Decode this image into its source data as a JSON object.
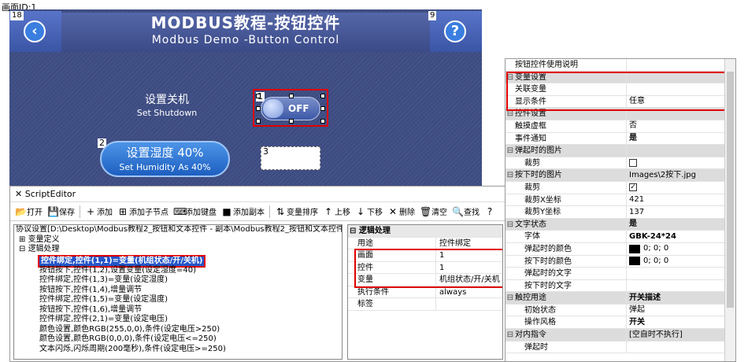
{
  "canvas": {
    "title": "画面ID:1"
  },
  "hmi": {
    "title": "MODBUS教程-按钮控件",
    "subtitle": "Modbus Demo -Button Control",
    "back_id": "18",
    "help_id": "9",
    "shutdown_cn": "设置关机",
    "shutdown_en": "Set Shutdown",
    "toggle_id": "1",
    "toggle_text": "OFF",
    "humidity_id": "2",
    "humidity_cn": "设置湿度 40%",
    "humidity_en": "Set Humidity As 40%",
    "empty_id": "3",
    "icons": {
      "back": "chevron-left-icon",
      "help": "question-icon"
    }
  },
  "script_editor": {
    "title": "ScriptEditor",
    "toolbar": [
      {
        "name": "open",
        "icon": "📂",
        "label": "打开"
      },
      {
        "name": "save",
        "icon": "💾",
        "label": "保存"
      },
      {
        "name": "add",
        "icon": "+",
        "label": "添加"
      },
      {
        "name": "add-child",
        "icon": "⊞",
        "label": "添加子节点"
      },
      {
        "name": "add-keyboard",
        "icon": "⌨",
        "label": "添加键盘"
      },
      {
        "name": "add-copy",
        "icon": "■",
        "label": "添加副本"
      },
      {
        "name": "sort-vars",
        "icon": "⇅",
        "label": "变量排序"
      },
      {
        "name": "move-up",
        "icon": "↑",
        "label": "上移"
      },
      {
        "name": "move-down",
        "icon": "↓",
        "label": "下移"
      },
      {
        "name": "delete",
        "icon": "✕",
        "label": "删除"
      },
      {
        "name": "clear",
        "icon": "🗑",
        "label": "清空"
      },
      {
        "name": "find",
        "icon": "🔍",
        "label": "查找"
      },
      {
        "name": "help",
        "icon": "?",
        "label": ""
      }
    ],
    "tree": {
      "root": "协议设置[D:\\Desktop\\Modbus教程2_按钮和文本控件 - 副本\\Modbus教程2_按钮和文本控件\\Modbus",
      "var_def": "变量定义",
      "logic": "逻辑处理",
      "selected": "控件绑定,控件(1,1)=变量(机组状态/开/关机)",
      "items": [
        "按钮按下,控件(1,2),设置变量(设定湿度=40)",
        "控件绑定,控件(1,3)=变量(设定湿度)",
        "按钮按下,控件(1,4),增量调节",
        "控件绑定,控件(1,5)=变量(设定温度)",
        "按钮按下,控件(1,6),增量调节",
        "控件绑定,控件(2,1)=变量(设定电压)",
        "颜色设置,颜色RGB(255,0,0),条件(设定电压>250)",
        "颜色设置,颜色RGB(0,0,0),条件(设定电压<=250)",
        "文本闪烁,闪烁周期(200毫秒),条件(设定电压>=250)"
      ]
    },
    "props": {
      "header": "逻辑处理",
      "rows": [
        {
          "k": "用途",
          "v": "控件绑定"
        },
        {
          "k": "画面",
          "v": "1"
        },
        {
          "k": "控件",
          "v": "1"
        },
        {
          "k": "变量",
          "v": "机组状态/开/关机"
        },
        {
          "k": "执行条件",
          "v": "always"
        },
        {
          "k": "标签",
          "v": ""
        }
      ]
    }
  },
  "property_grid": {
    "rows": [
      {
        "type": "item",
        "k": "按钮控件使用说明",
        "v": ""
      },
      {
        "type": "cat",
        "k": "变量设置",
        "v": ""
      },
      {
        "type": "item",
        "k": "关联变量",
        "v": ""
      },
      {
        "type": "item",
        "k": "显示条件",
        "v": "任意"
      },
      {
        "type": "cat",
        "k": "控件设置",
        "v": ""
      },
      {
        "type": "item",
        "k": "触摸虚框",
        "v": "否"
      },
      {
        "type": "item",
        "k": "事件通知",
        "v": "是",
        "bold": true
      },
      {
        "type": "cat",
        "k": "弹起时的图片",
        "v": ""
      },
      {
        "type": "sub",
        "k": "裁剪",
        "v": "",
        "check": ""
      },
      {
        "type": "cat",
        "k": "按下时的图片",
        "v": "Images\\2按下.jpg"
      },
      {
        "type": "sub",
        "k": "裁剪",
        "v": "",
        "check": "✓"
      },
      {
        "type": "sub",
        "k": "裁剪X坐标",
        "v": "421"
      },
      {
        "type": "sub",
        "k": "裁剪Y坐标",
        "v": "137"
      },
      {
        "type": "cat",
        "k": "文字状态",
        "v": "是",
        "bold": true
      },
      {
        "type": "sub",
        "k": "字体",
        "v": "GBK-24*24",
        "bold": true
      },
      {
        "type": "sub",
        "k": "弹起时的颜色",
        "v": "0; 0; 0",
        "swatch": "#000000"
      },
      {
        "type": "sub",
        "k": "按下时的颜色",
        "v": "0; 0; 0",
        "swatch": "#000000"
      },
      {
        "type": "sub",
        "k": "弹起时的文字",
        "v": ""
      },
      {
        "type": "sub",
        "k": "按下时的文字",
        "v": ""
      },
      {
        "type": "cat",
        "k": "触控用途",
        "v": "开关描述",
        "bold": true
      },
      {
        "type": "sub",
        "k": "初始状态",
        "v": "弹起"
      },
      {
        "type": "sub",
        "k": "操作风格",
        "v": "开关",
        "bold": true
      },
      {
        "type": "cat",
        "k": "对内指令",
        "v": "[空自时不执行]"
      },
      {
        "type": "sub",
        "k": "弹起时",
        "v": ""
      }
    ]
  }
}
